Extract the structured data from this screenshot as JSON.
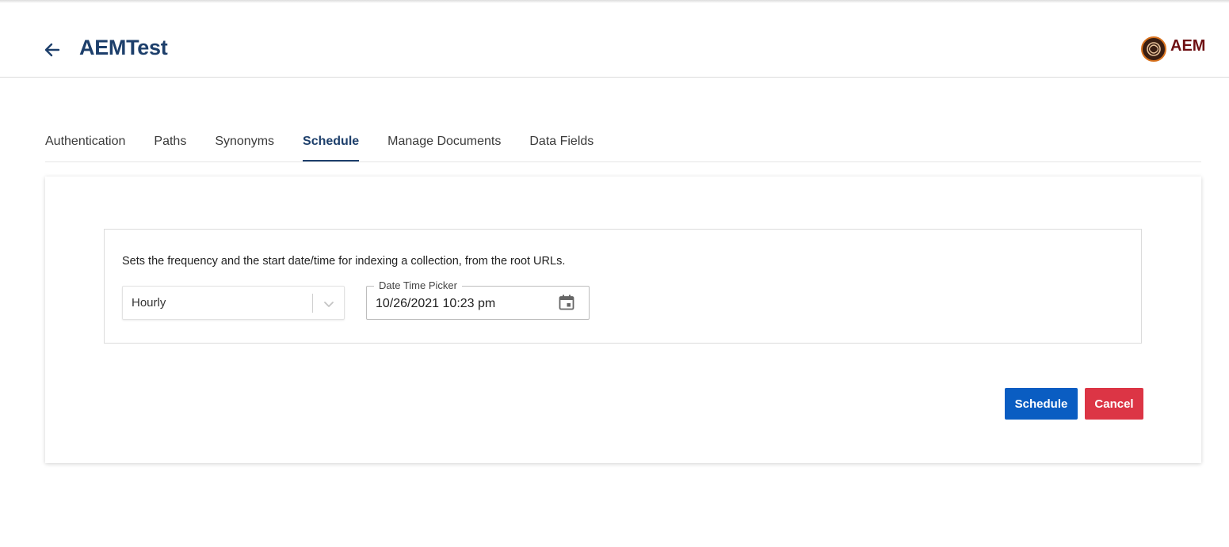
{
  "header": {
    "title": "AEMTest",
    "back_icon": "arrow-left-icon",
    "logo": {
      "text": "AEM",
      "icon": "aem-logo-icon"
    }
  },
  "tabs": [
    {
      "label": "Authentication",
      "active": false
    },
    {
      "label": "Paths",
      "active": false
    },
    {
      "label": "Synonyms",
      "active": false
    },
    {
      "label": "Schedule",
      "active": true
    },
    {
      "label": "Manage Documents",
      "active": false
    },
    {
      "label": "Data Fields",
      "active": false
    }
  ],
  "schedule": {
    "description": "Sets the frequency and the start date/time for indexing a collection, from the root URLs.",
    "frequency": {
      "selected": "Hourly",
      "icon": "chevron-down-icon"
    },
    "datetime": {
      "label": "Date Time Picker",
      "value": "10/26/2021 10:23 pm",
      "icon": "calendar-icon"
    }
  },
  "actions": {
    "schedule_label": "Schedule",
    "cancel_label": "Cancel"
  },
  "colors": {
    "title": "#1d3f6b",
    "primary": "#0a5dc2",
    "danger": "#dc3545",
    "logo_text": "#6e0f12"
  }
}
